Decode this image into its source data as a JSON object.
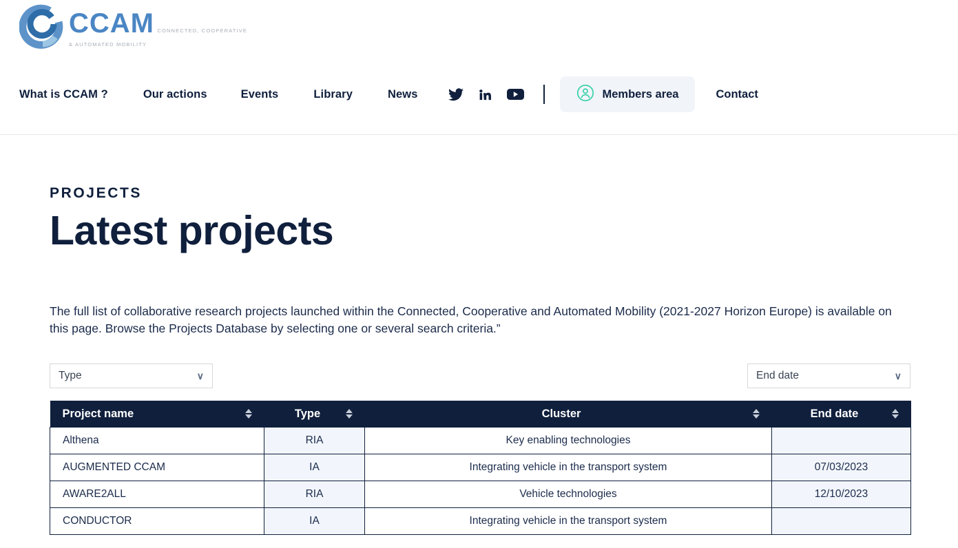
{
  "brand": {
    "name": "CCAM",
    "tagline_line1": "CONNECTED, COOPERATIVE",
    "tagline_line2": "& AUTOMATED MOBILITY",
    "logo_blue": "#4B86C4",
    "logo_light_blue": "#BFD9EC",
    "logo_dark_blue": "#2E6DA8"
  },
  "nav": {
    "items": [
      {
        "label": "What is CCAM ?"
      },
      {
        "label": "Our actions"
      },
      {
        "label": "Events"
      },
      {
        "label": "Library"
      },
      {
        "label": "News"
      }
    ],
    "social": [
      {
        "name": "twitter-icon"
      },
      {
        "name": "linkedin-icon"
      },
      {
        "name": "youtube-icon"
      }
    ],
    "members_label": "Members area",
    "members_icon": "user-circle-icon",
    "members_icon_color": "#2ECFA4",
    "contact_label": "Contact"
  },
  "page": {
    "eyebrow": "PROJECTS",
    "title": "Latest projects",
    "intro": "The full list of collaborative research projects launched within the Connected, Cooperative and Automated Mobility (2021-2027 Horizon Europe) is available on this page. Browse the Projects Database by selecting one or several search criteria.”"
  },
  "filters": {
    "type": {
      "value": "Type",
      "chevron": "∨"
    },
    "end_date": {
      "value": "End date",
      "chevron": "∨"
    }
  },
  "table": {
    "columns": [
      {
        "label": "Project name",
        "sortable": true
      },
      {
        "label": "Type",
        "sortable": true
      },
      {
        "label": "Cluster",
        "sortable": true
      },
      {
        "label": "End date",
        "sortable": true
      }
    ],
    "rows": [
      {
        "name": "Althena",
        "type": "RIA",
        "cluster": "Key enabling technologies",
        "end_date": ""
      },
      {
        "name": "AUGMENTED CCAM",
        "type": "IA",
        "cluster": "Integrating vehicle in the transport system",
        "end_date": "07/03/2023"
      },
      {
        "name": "AWARE2ALL",
        "type": "RIA",
        "cluster": "Vehicle technologies",
        "end_date": "12/10/2023"
      },
      {
        "name": "CONDUCTOR",
        "type": "IA",
        "cluster": "Integrating vehicle in the transport system",
        "end_date": ""
      }
    ]
  },
  "theme": {
    "navy": "#0F1F3C",
    "tinted_cell": "#F2F6FC",
    "members_bg": "#F1F4F9"
  }
}
